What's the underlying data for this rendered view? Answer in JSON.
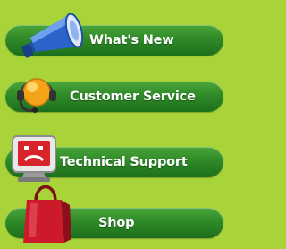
{
  "nav": {
    "items": [
      {
        "label": "What's New",
        "icon": "megaphone-icon"
      },
      {
        "label": "Customer Service",
        "icon": "headset-icon"
      },
      {
        "label": "Technical Support",
        "icon": "computer-monitor-icon"
      },
      {
        "label": "Shop",
        "icon": "shopping-bag-icon"
      }
    ]
  },
  "colors": {
    "background": "#a8d43a",
    "button_green": "#2f8a28",
    "megaphone_blue": "#2a63c9",
    "headset_orange": "#f5a318",
    "monitor_red": "#d9232a",
    "bag_red": "#cc1a2a"
  }
}
